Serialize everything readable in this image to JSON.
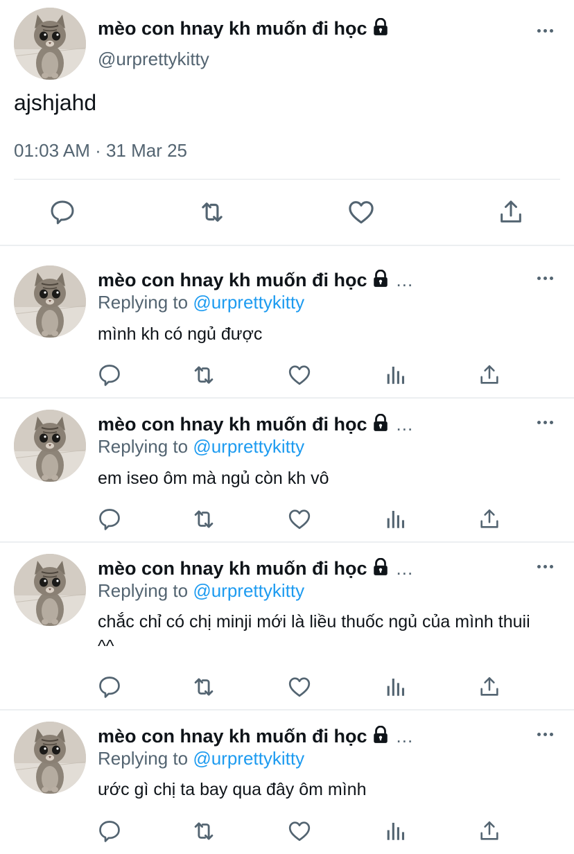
{
  "main_tweet": {
    "display_name": "mèo con hnay kh muốn đi học",
    "handle": "@urprettykitty",
    "text": "ajshjahd",
    "timestamp": "01:03 AM · 31 Mar 25",
    "avatar_icon": "kitten-avatar",
    "actions": [
      "reply-icon",
      "retweet-icon",
      "like-icon",
      "share-icon"
    ]
  },
  "replies": [
    {
      "display_name": "mèo con hnay kh muốn đi học",
      "ellipsis": "...",
      "replying_prefix": "Replying to",
      "replying_handle": "@urprettykitty",
      "text": "mình kh có ngủ được"
    },
    {
      "display_name": "mèo con hnay kh muốn đi học",
      "ellipsis": "...",
      "replying_prefix": "Replying to",
      "replying_handle": "@urprettykitty",
      "text": "em iseo ôm mà ngủ còn kh vô"
    },
    {
      "display_name": "mèo con hnay kh muốn đi học",
      "ellipsis": "...",
      "replying_prefix": "Replying to",
      "replying_handle": "@urprettykitty",
      "text": "chắc chỉ có chị minji mới là liều thuốc ngủ của mình thuii ^^"
    },
    {
      "display_name": "mèo con hnay kh muốn đi học",
      "ellipsis": "...",
      "replying_prefix": "Replying to",
      "replying_handle": "@urprettykitty",
      "text": "ước gì chị ta bay qua đây ôm mình"
    }
  ],
  "colors": {
    "text": "#0f1419",
    "secondary": "#536471",
    "link": "#1d9bf0",
    "divider": "#eceff1"
  }
}
